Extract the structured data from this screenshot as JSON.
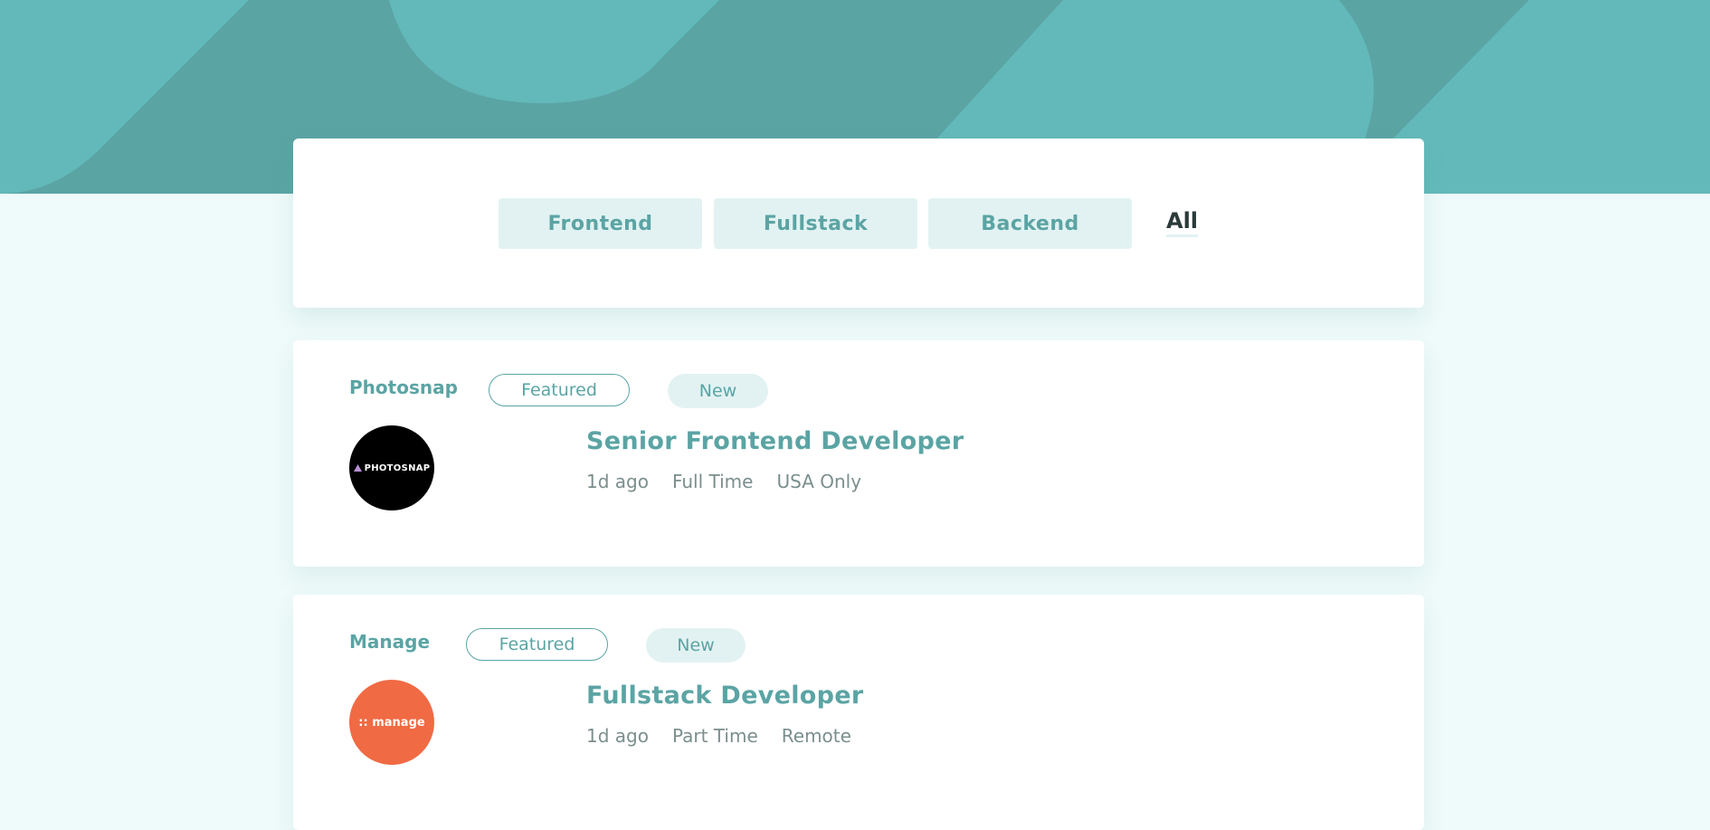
{
  "colors": {
    "primary": "#5ba4a4",
    "tag_bg": "#e2f2f2",
    "page_bg": "#effafa",
    "photosnap_logo": "#000000",
    "manage_logo": "#f06a43",
    "dark_text": "#2c3a3a",
    "muted_text": "#7b8e8e"
  },
  "filters": {
    "tags": [
      "Frontend",
      "Fullstack",
      "Backend"
    ],
    "clear_label": "All"
  },
  "jobs": [
    {
      "company": "Photosnap",
      "featured_label": "Featured",
      "new_label": "New",
      "logo_text": "PHOTOSNAP",
      "title": "Senior Frontend Developer",
      "posted": "1d ago",
      "contract": "Full Time",
      "location": "USA Only"
    },
    {
      "company": "Manage",
      "featured_label": "Featured",
      "new_label": "New",
      "logo_text": ":: manage",
      "title": "Fullstack Developer",
      "posted": "1d ago",
      "contract": "Part Time",
      "location": "Remote"
    }
  ]
}
